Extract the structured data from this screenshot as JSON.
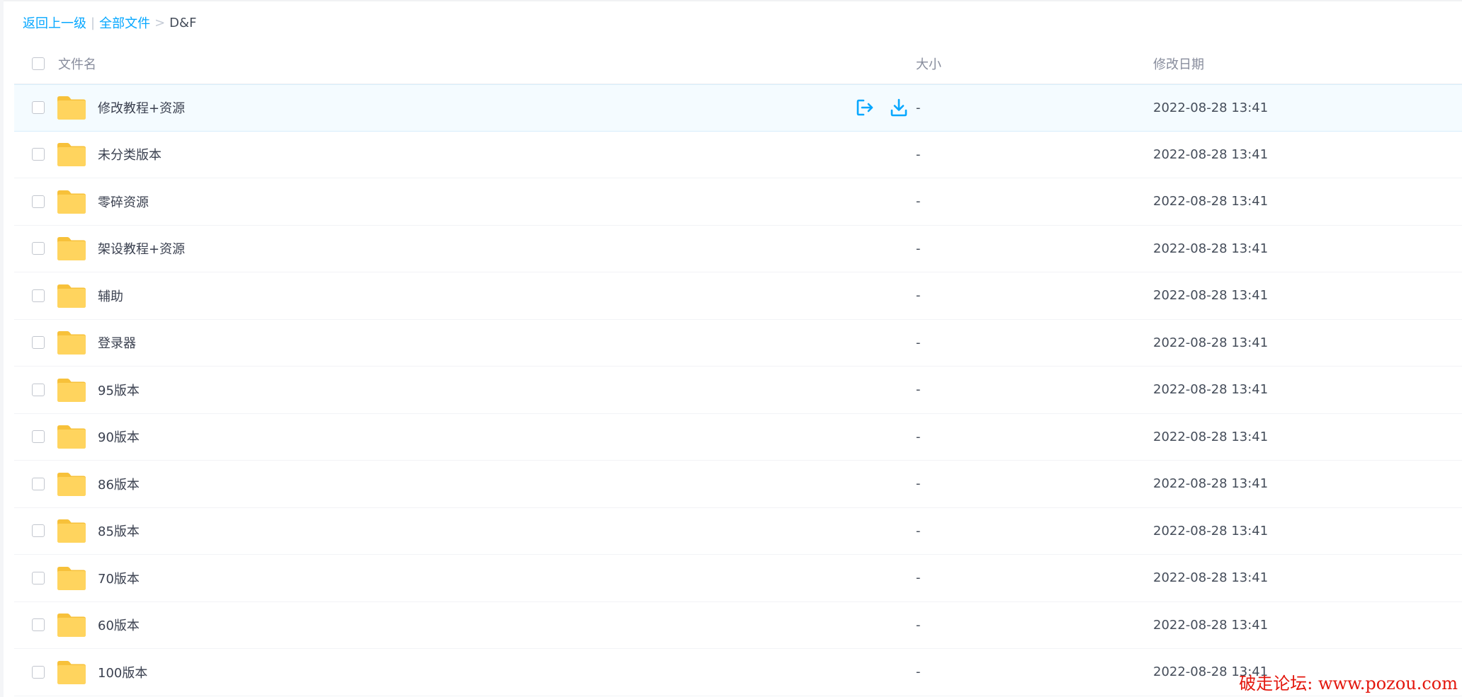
{
  "breadcrumb": {
    "back": "返回上一级",
    "separator_bar": "|",
    "all_files": "全部文件",
    "separator_arrow": ">",
    "current": "D&F"
  },
  "columns": {
    "name": "文件名",
    "size": "大小",
    "date": "修改日期"
  },
  "rows": [
    {
      "name": "修改教程+资源",
      "size": "-",
      "date": "2022-08-28 13:41"
    },
    {
      "name": "未分类版本",
      "size": "-",
      "date": "2022-08-28 13:41"
    },
    {
      "name": "零碎资源",
      "size": "-",
      "date": "2022-08-28 13:41"
    },
    {
      "name": "架设教程+资源",
      "size": "-",
      "date": "2022-08-28 13:41"
    },
    {
      "name": "辅助",
      "size": "-",
      "date": "2022-08-28 13:41"
    },
    {
      "name": "登录器",
      "size": "-",
      "date": "2022-08-28 13:41"
    },
    {
      "name": "95版本",
      "size": "-",
      "date": "2022-08-28 13:41"
    },
    {
      "name": "90版本",
      "size": "-",
      "date": "2022-08-28 13:41"
    },
    {
      "name": "86版本",
      "size": "-",
      "date": "2022-08-28 13:41"
    },
    {
      "name": "85版本",
      "size": "-",
      "date": "2022-08-28 13:41"
    },
    {
      "name": "70版本",
      "size": "-",
      "date": "2022-08-28 13:41"
    },
    {
      "name": "60版本",
      "size": "-",
      "date": "2022-08-28 13:41"
    },
    {
      "name": "100版本",
      "size": "-",
      "date": "2022-08-28 13:41"
    }
  ],
  "hovered_row_index": 0,
  "row_action_icons": [
    "share-icon",
    "download-icon"
  ],
  "watermark": "破走论坛: www.pozou.com",
  "colors": {
    "link": "#06a7ff",
    "folder": "#ffd45e",
    "hover_row": "#f4fbff",
    "watermark": "#e3170d"
  }
}
